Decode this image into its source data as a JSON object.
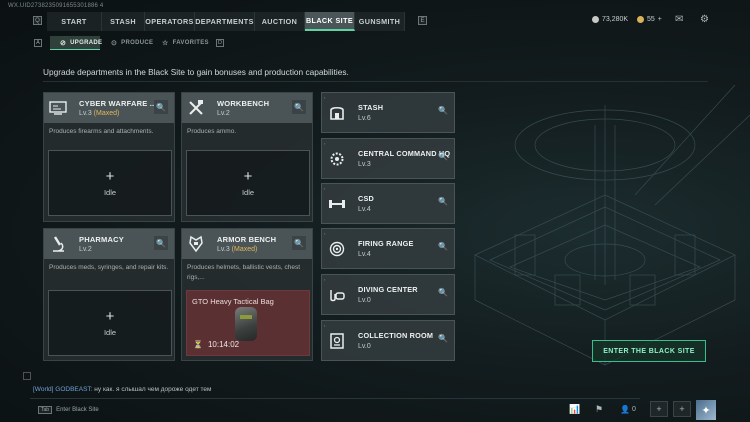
{
  "uid": "WX.UID2738235091655301886 4",
  "nav": {
    "key_left": "Q",
    "key_right": "E",
    "tabs": [
      {
        "label": "START"
      },
      {
        "label": "STASH"
      },
      {
        "label": "OPERATORS"
      },
      {
        "label": "DEPARTMENTS"
      },
      {
        "label": "AUCTION"
      },
      {
        "label": "BLACK SITE"
      },
      {
        "label": "GUNSMITH"
      }
    ],
    "active_tab": "BLACK SITE",
    "currency_1": "73,280K",
    "currency_2": "55",
    "currency_2_plus": "+"
  },
  "subnav": {
    "key_left": "A",
    "key_right": "D",
    "tabs": [
      {
        "label": "UPGRADE"
      },
      {
        "label": "PRODUCE"
      },
      {
        "label": "FAVORITES"
      }
    ]
  },
  "description": "Upgrade departments in the Black Site to gain bonuses and production capabilities.",
  "departments": [
    {
      "title": "CYBER WARFARE ...",
      "level": "Lv.3",
      "maxed": "(Maxed)",
      "produces": "Produces firearms and attachments.",
      "slot_status": "Idle"
    },
    {
      "title": "WORKBENCH",
      "level": "Lv.2",
      "maxed": "",
      "produces": "Produces ammo.",
      "slot_status": "Idle"
    },
    {
      "title": "PHARMACY",
      "level": "Lv.2",
      "maxed": "",
      "produces": "Produces meds, syringes, and repair kits.",
      "slot_status": "Idle"
    },
    {
      "title": "ARMOR BENCH",
      "level": "Lv.3",
      "maxed": "(Maxed)",
      "produces": "Produces helmets, ballistic vests, chest rigs,...",
      "item_name": "GTO Heavy Tactical Bag",
      "timer": "10:14:02"
    }
  ],
  "rooms": [
    {
      "title": "STASH",
      "level": "Lv.6"
    },
    {
      "title": "CENTRAL COMMAND HQ",
      "level": "Lv.3"
    },
    {
      "title": "CSD",
      "level": "Lv.4"
    },
    {
      "title": "FIRING RANGE",
      "level": "Lv.4"
    },
    {
      "title": "DIVING CENTER",
      "level": "Lv.0"
    },
    {
      "title": "COLLECTION ROOM",
      "level": "Lv.0"
    }
  ],
  "enter_button": "ENTER THE BLACK SITE",
  "chat": {
    "channel": "[World] GODBEAST:",
    "message": "ну как. я слышал чем дороже одет тем"
  },
  "hint": {
    "key": "Tab",
    "label": "Enter Black Site"
  },
  "friends_count": "0",
  "colors": {
    "accent": "#5fd3a4",
    "maxed": "#e1b65a",
    "busy_slot": "#5a3032"
  }
}
